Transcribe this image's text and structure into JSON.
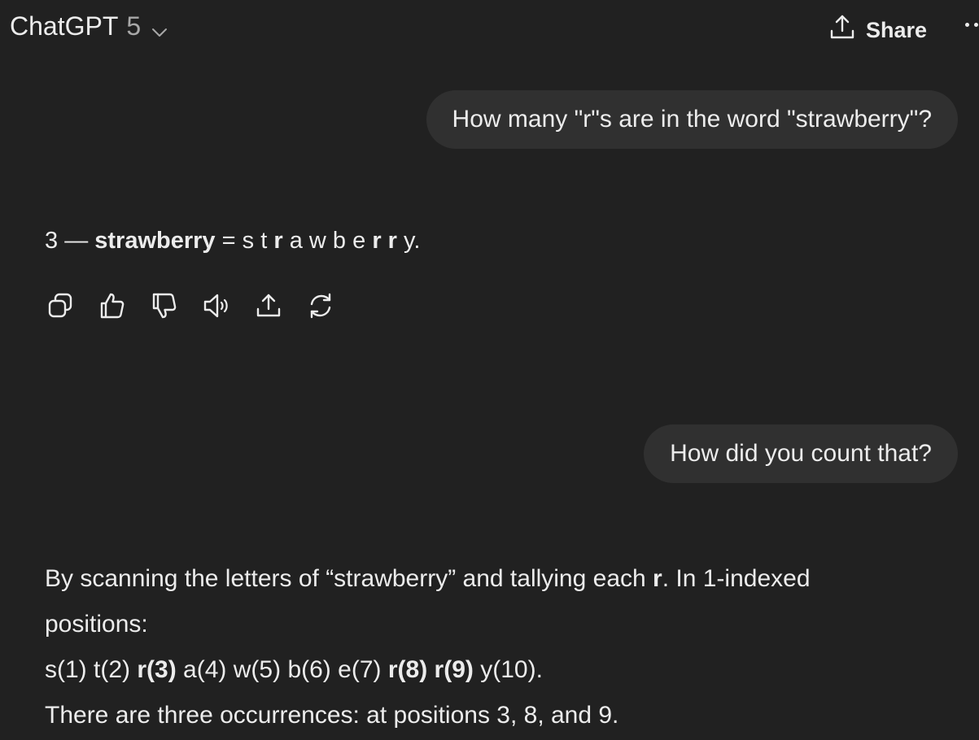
{
  "header": {
    "model_name": "ChatGPT",
    "model_version": "5",
    "share_label": "Share"
  },
  "conversation": {
    "user_message_1": "How many \"r\"s are in the word \"strawberry\"?",
    "answer_1": {
      "count": "3",
      "dash": "—",
      "word": "strawberry",
      "equals": "=",
      "letters": [
        "s",
        "t",
        "r",
        "a",
        "w",
        "b",
        "e",
        "r",
        "r",
        "y"
      ],
      "bold_letters": [
        false,
        false,
        true,
        false,
        false,
        false,
        false,
        true,
        true,
        false
      ],
      "end": "."
    },
    "user_message_2": "How did you count that?",
    "answer_2": {
      "line1_pre": "By scanning the letters of “strawberry” and tallying each ",
      "line1_bold": "r",
      "line1_post": ". In 1-indexed",
      "line2": "positions:",
      "positions": [
        {
          "text": "s(1)",
          "bold": false
        },
        {
          "text": "t(2)",
          "bold": false
        },
        {
          "text": "r(3)",
          "bold": true
        },
        {
          "text": "a(4)",
          "bold": false
        },
        {
          "text": "w(5)",
          "bold": false
        },
        {
          "text": "b(6)",
          "bold": false
        },
        {
          "text": "e(7)",
          "bold": false
        },
        {
          "text": "r(8)",
          "bold": true
        },
        {
          "text": "r(9)",
          "bold": true
        },
        {
          "text": "y(10)",
          "bold": false
        }
      ],
      "positions_end": ".",
      "line4": "There are three occurrences: at positions 3, 8, and 9."
    }
  },
  "actions": [
    {
      "icon": "copy-icon"
    },
    {
      "icon": "thumbs-up-icon"
    },
    {
      "icon": "thumbs-down-icon"
    },
    {
      "icon": "read-aloud-icon"
    },
    {
      "icon": "share-icon"
    },
    {
      "icon": "regenerate-icon"
    }
  ],
  "colors": {
    "background": "#212121",
    "bubble": "#303030",
    "text": "#ececec",
    "muted": "#a8a8a8"
  }
}
